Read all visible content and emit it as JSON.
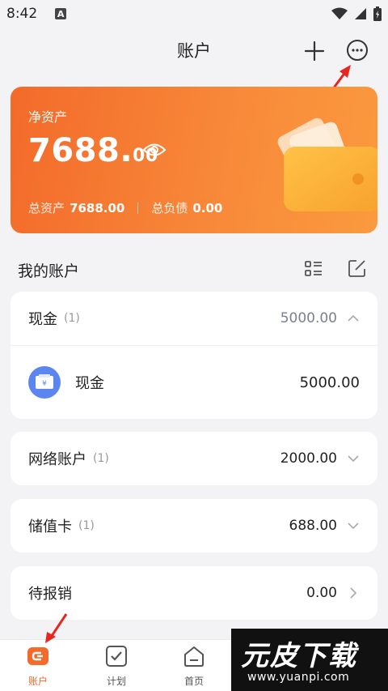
{
  "status_bar": {
    "time": "8:42",
    "notification_letter": "A"
  },
  "header": {
    "title": "账户"
  },
  "asset_card": {
    "label": "净资产",
    "amount_int": "7688.",
    "amount_dec": "00",
    "total_assets_label": "总资产",
    "total_assets_value": "7688.00",
    "total_liabilities_label": "总负债",
    "total_liabilities_value": "0.00"
  },
  "section": {
    "title": "我的账户"
  },
  "groups": [
    {
      "name": "现金",
      "count": "(1)",
      "total": "5000.00",
      "expanded": true,
      "accounts": [
        {
          "name": "现金",
          "amount": "5000.00"
        }
      ]
    },
    {
      "name": "网络账户",
      "count": "(1)",
      "total": "2000.00",
      "expanded": false
    },
    {
      "name": "储值卡",
      "count": "(1)",
      "total": "688.00",
      "expanded": false
    },
    {
      "name": "待报销",
      "count": "",
      "total": "0.00",
      "expanded": false
    }
  ],
  "nav": [
    {
      "label": "账户",
      "active": true
    },
    {
      "label": "计划",
      "active": false
    },
    {
      "label": "首页",
      "active": false
    }
  ],
  "watermark": {
    "brand": "元皮下载",
    "url": "www.yuanpi.com"
  },
  "colors": {
    "accent": "#f36a2a",
    "annotation": "#e8251f",
    "account_icon": "#5b86f0"
  }
}
